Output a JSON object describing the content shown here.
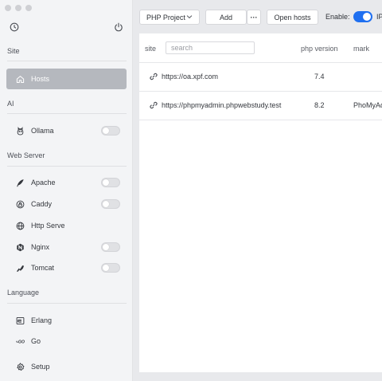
{
  "window": {
    "controls": [
      "close",
      "minimize",
      "zoom"
    ]
  },
  "sidebar": {
    "top_icons": [
      "history-icon",
      "power-icon"
    ],
    "sections": {
      "site": "Site",
      "ai": "AI",
      "web_server": "Web Server",
      "language": "Language"
    },
    "items": {
      "hosts": "Hosts",
      "ollama": "Ollama",
      "apache": "Apache",
      "caddy": "Caddy",
      "http_serve": "Http Serve",
      "nginx": "Nginx",
      "tomcat": "Tomcat",
      "erlang": "Erlang",
      "go": "Go",
      "setup": "Setup"
    },
    "active_item": "hosts"
  },
  "toolbar": {
    "project_select": "PHP Project",
    "add_label": "Add",
    "more_label": "···",
    "open_hosts_label": "Open hosts",
    "enable_label": "Enable:",
    "enable_on": true,
    "ip_label": "IP"
  },
  "table": {
    "headers": {
      "site": "site",
      "php": "php version",
      "mark": "mark"
    },
    "search_placeholder": "search",
    "rows": [
      {
        "site": "https://oa.xpf.com",
        "php": "7.4",
        "mark": ""
      },
      {
        "site": "https://phpmyadmin.phpwebstudy.test",
        "php": "8.2",
        "mark": "PhoMyAd"
      }
    ]
  },
  "colors": {
    "accent": "#1f6ff0",
    "active_item_bg": "#b5b8be",
    "sidebar_bg": "#f3f4f6",
    "window_bg": "#e8e9ec"
  }
}
